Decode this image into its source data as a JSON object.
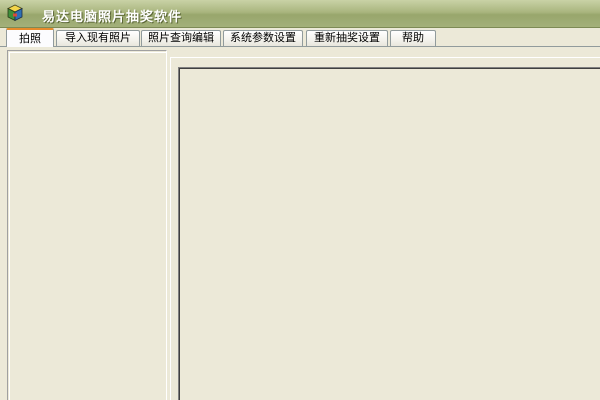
{
  "window": {
    "title": "易达电脑照片抽奖软件",
    "icon": "app-box-icon"
  },
  "tabs": [
    {
      "label": "拍照",
      "active": true
    },
    {
      "label": "导入现有照片",
      "active": false
    },
    {
      "label": "照片查询编辑",
      "active": false
    },
    {
      "label": "系统参数设置",
      "active": false
    },
    {
      "label": "重新抽奖设置",
      "active": false
    },
    {
      "label": "帮助",
      "active": false
    }
  ],
  "colors": {
    "titlebar": "#A9B57E",
    "background": "#ECE9D8",
    "active_tab_accent": "#E68B2C"
  }
}
